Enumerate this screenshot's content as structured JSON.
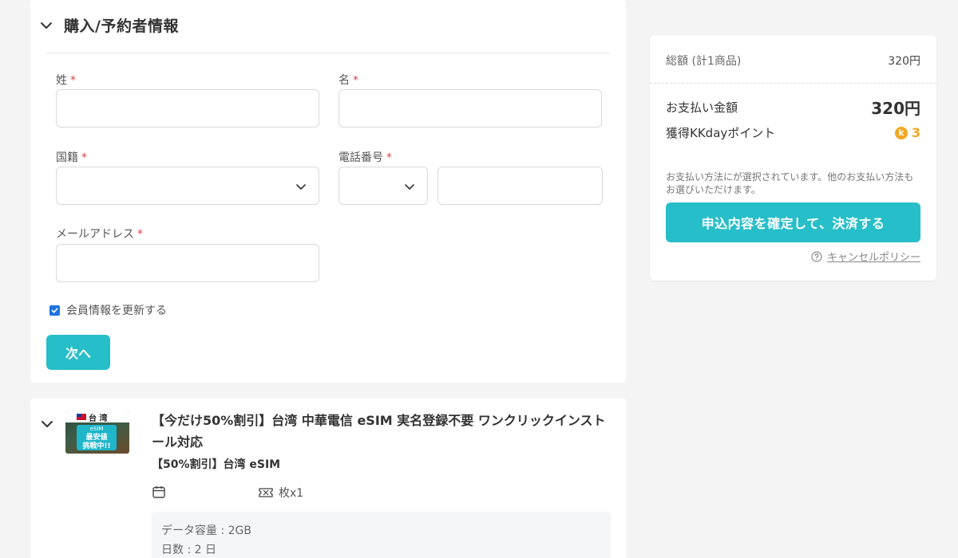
{
  "form": {
    "section_title": "購入/予約者情報",
    "last_name_label": "姓",
    "first_name_label": "名",
    "nationality_label": "国籍",
    "phone_label": "電話番号",
    "email_label": "メールアドレス",
    "required_mark": "*",
    "update_member_label": "会員情報を更新する",
    "next_button": "次へ"
  },
  "summary": {
    "total_label": "総額 (計1商品)",
    "total_value": "320円",
    "payment_label": "お支払い金額",
    "payment_value": "320円",
    "points_label": "獲得KKdayポイント",
    "points_value": "3",
    "coin_letter": "k",
    "note": "お支払い方法にが選択されています。他のお支払い方法もお選びいただけます。",
    "pay_button": "申込内容を確定して、決済する",
    "policy_link": "キャンセルポリシー"
  },
  "product": {
    "thumb_flag_text": "台 湾",
    "thumb_esim": "eSIM",
    "thumb_badge_line1": "最安値",
    "thumb_badge_line2": "挑戦中!!",
    "title": "【今だけ50%割引】台湾 中華電信 eSIM 実名登録不要 ワンクリックインストール対応",
    "subtitle": "【50%割引】台湾 eSIM",
    "date_value": "",
    "quantity": "枚x1",
    "detail_capacity": "データ容量 : 2GB",
    "detail_days": "日数 : 2 日"
  },
  "colors": {
    "accent": "#26bec9",
    "required": "#e0424a",
    "coin": "#f5a623",
    "checkbox": "#1f73e0"
  }
}
